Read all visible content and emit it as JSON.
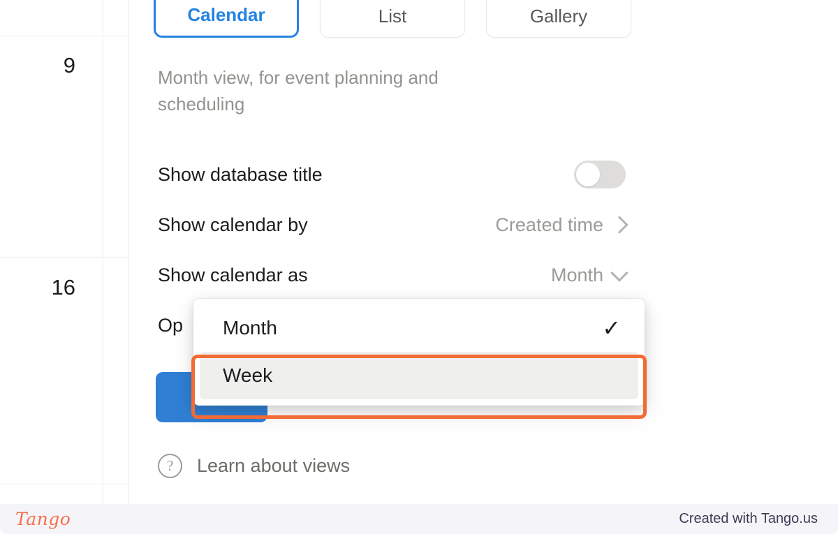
{
  "calendar": {
    "day_numbers": [
      "9",
      "16"
    ]
  },
  "panel": {
    "tabs": [
      {
        "label": "Calendar",
        "active": true
      },
      {
        "label": "List",
        "active": false
      },
      {
        "label": "Gallery",
        "active": false
      }
    ],
    "description": "Month view, for event planning and scheduling",
    "settings": [
      {
        "label": "Show database title",
        "control": "toggle",
        "value": "off"
      },
      {
        "label": "Show calendar by",
        "control": "chevron-right",
        "value": "Created time"
      },
      {
        "label": "Show calendar as",
        "control": "chevron-down",
        "value": "Month"
      },
      {
        "label": "Op",
        "control": "none",
        "value": ""
      }
    ],
    "learn_link": "Learn about views",
    "help_icon_glyph": "?"
  },
  "dropdown": {
    "items": [
      {
        "label": "Month",
        "selected": true,
        "hovered": false,
        "check": "✓"
      },
      {
        "label": "Week",
        "selected": false,
        "hovered": true,
        "check": ""
      }
    ]
  },
  "footer": {
    "logo": "Tango",
    "credit": "Created with Tango.us"
  },
  "colors": {
    "accent_blue": "#2383e2",
    "button_blue": "#2f7fd4",
    "highlight_orange": "#f26b34",
    "tango_orange": "#f4704a",
    "muted_text": "#9b9b97",
    "grid_line": "#ececeb"
  }
}
